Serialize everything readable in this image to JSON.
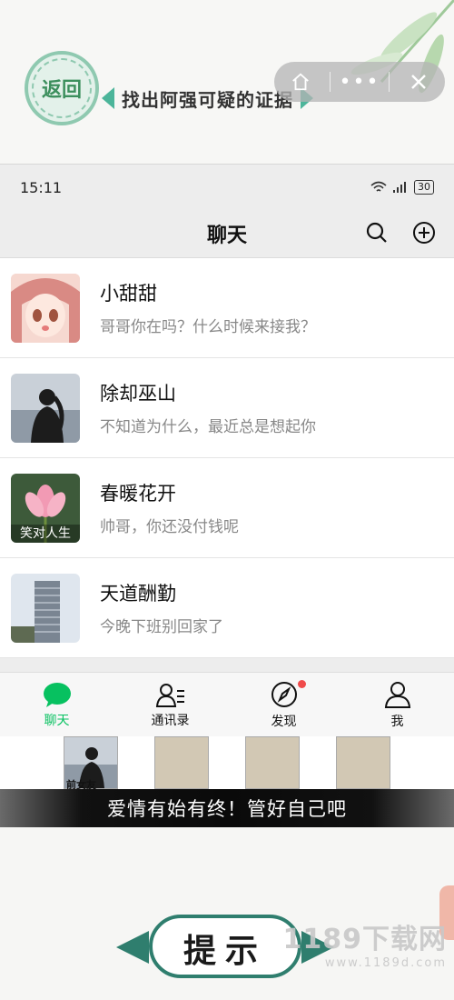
{
  "game": {
    "back_label": "返回",
    "task_title": "找出阿强可疑的证据"
  },
  "phone": {
    "status_time": "15:11",
    "battery": "30",
    "nav_title": "聊天",
    "chats": [
      {
        "name": "小甜甜",
        "preview": "哥哥你在吗？什么时候来接我？",
        "avatar": "anime-girl"
      },
      {
        "name": "除却巫山",
        "preview": "不知道为什么，最近总是想起你",
        "avatar": "silhouette"
      },
      {
        "name": "春暖花开",
        "preview": "帅哥，你还没付钱呢",
        "avatar": "lotus",
        "avatar_caption": "笑对人生"
      },
      {
        "name": "天道酬勤",
        "preview": "今晚下班别回家了",
        "avatar": "building"
      }
    ],
    "tabs": [
      {
        "label": "聊天",
        "icon": "chat-bubble-icon",
        "active": true
      },
      {
        "label": "通讯录",
        "icon": "contacts-icon",
        "active": false
      },
      {
        "label": "发现",
        "icon": "compass-icon",
        "active": false,
        "badge": true
      },
      {
        "label": "我",
        "icon": "person-icon",
        "active": false
      }
    ]
  },
  "evidence": {
    "found_label": "前女友"
  },
  "hint_text": "爱情有始有终！管好自己吧",
  "hint_button": "提示",
  "watermark": {
    "main": "1189下载网",
    "sub": "www.1189d.com"
  },
  "colors": {
    "accent_green": "#07c160",
    "teal": "#2f7e6e",
    "badge_red": "#f04b4b"
  }
}
